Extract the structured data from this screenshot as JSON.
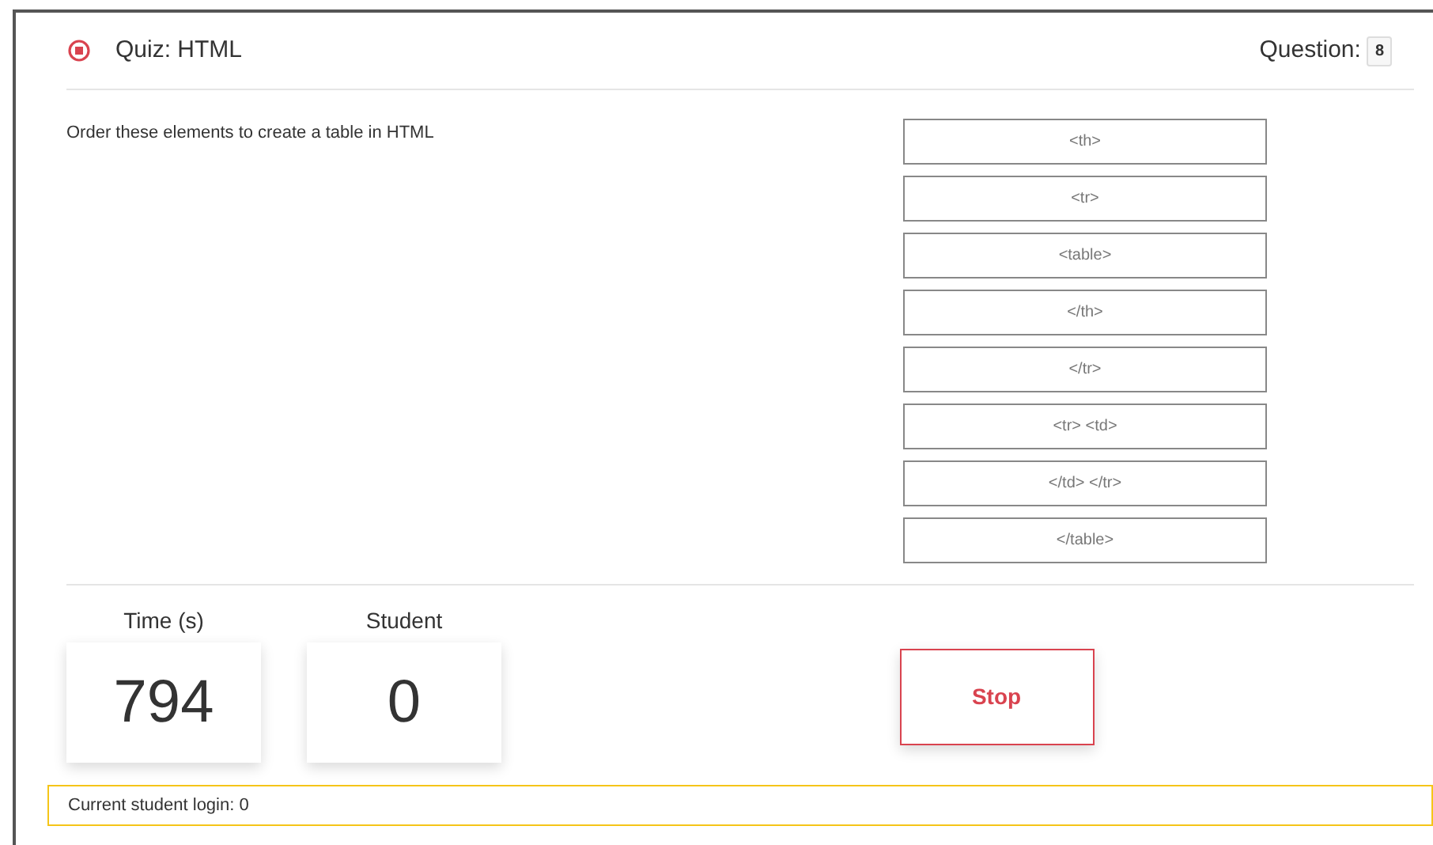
{
  "header": {
    "title": "Quiz: HTML",
    "question_label": "Question:",
    "question_number": "8"
  },
  "prompt": "Order these elements to create a table in HTML",
  "items": [
    "<th>",
    "<tr>",
    "<table>",
    "</th>",
    "</tr>",
    "<tr> <td>",
    "</td> </tr>",
    "</table>"
  ],
  "stats": [
    {
      "label": "Time (s)",
      "value": "794"
    },
    {
      "label": "Student",
      "value": "0"
    }
  ],
  "stop_button": "Stop",
  "status": "Current student login: 0"
}
